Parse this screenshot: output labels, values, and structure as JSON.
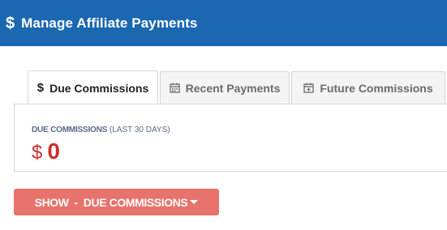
{
  "header": {
    "icon": "dollar-icon",
    "icon_glyph": "$",
    "title": "Manage Affiliate Payments"
  },
  "tabs": [
    {
      "label": "Due Commissions",
      "icon": "dollar-icon",
      "icon_glyph": "$",
      "active": true
    },
    {
      "label": "Recent Payments",
      "icon": "calendar-icon",
      "active": false
    },
    {
      "label": "Future Commissions",
      "icon": "calendar-plus-icon",
      "active": false
    }
  ],
  "panel": {
    "label_strong": "Due Commissions",
    "label_sub": "(LAST 30 DAYS)",
    "currency": "$",
    "amount": "0"
  },
  "show_button": {
    "label": "SHOW  -  DUE COMMISSIONS"
  },
  "colors": {
    "header_bg": "#1b67b0",
    "amount": "#c9302c",
    "button_bg": "#e8736c"
  }
}
